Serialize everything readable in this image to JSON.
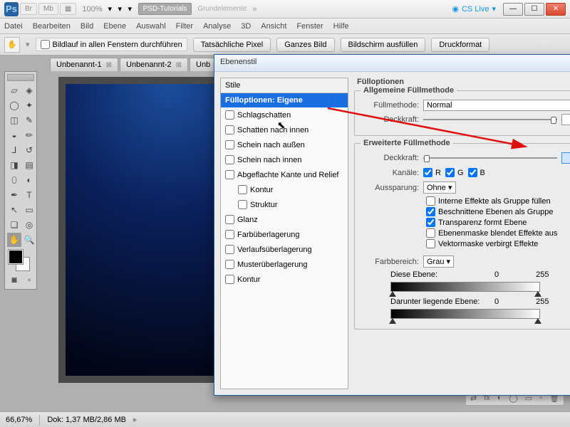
{
  "app": {
    "logo": "Ps",
    "zoom_label": "100%",
    "workspace": "PSD-Tutorials",
    "workspace2": "Grundelemente",
    "cslive": "CS Live"
  },
  "titlebar_buttons": [
    "Br",
    "Mb",
    "▦"
  ],
  "menu": [
    "Datei",
    "Bearbeiten",
    "Bild",
    "Ebene",
    "Auswahl",
    "Filter",
    "Analyse",
    "3D",
    "Ansicht",
    "Fenster",
    "Hilfe"
  ],
  "optionsbar": {
    "scroll_all": "Bildlauf in allen Fenstern durchführen",
    "btns": [
      "Tatsächliche Pixel",
      "Ganzes Bild",
      "Bildschirm ausfüllen",
      "Druckformat"
    ]
  },
  "tabs": [
    "Unbenannt-1",
    "Unbenannt-2",
    "Unb"
  ],
  "status": {
    "zoom": "66,67%",
    "doc": "Dok: 1,37 MB/2,86 MB"
  },
  "dialog": {
    "title": "Ebenenstil",
    "styles_header": "Stile",
    "items": [
      {
        "label": "Fülloptionen: Eigene",
        "checkbox": false,
        "selected": true
      },
      {
        "label": "Schlagschatten",
        "checkbox": true
      },
      {
        "label": "Schatten nach innen",
        "checkbox": true
      },
      {
        "label": "Schein nach außen",
        "checkbox": true
      },
      {
        "label": "Schein nach innen",
        "checkbox": true
      },
      {
        "label": "Abgeflachte Kante und Relief",
        "checkbox": true
      },
      {
        "label": "Kontur",
        "checkbox": true,
        "indent": true
      },
      {
        "label": "Struktur",
        "checkbox": true,
        "indent": true
      },
      {
        "label": "Glanz",
        "checkbox": true
      },
      {
        "label": "Farbüberlagerung",
        "checkbox": true
      },
      {
        "label": "Verlaufsüberlagerung",
        "checkbox": true
      },
      {
        "label": "Musterüberlagerung",
        "checkbox": true
      },
      {
        "label": "Kontur",
        "checkbox": true
      }
    ],
    "fill_options_title": "Fülloptionen",
    "general_title": "Allgemeine Füllmethode",
    "blend_mode_label": "Füllmethode:",
    "blend_mode_value": "Normal",
    "opacity_label": "Deckkraft:",
    "opacity_value": "100",
    "advanced_title": "Erweiterte Füllmethode",
    "adv_opacity_label": "Deckkraft:",
    "adv_opacity_value": "0",
    "channels_label": "Kanäle:",
    "channels": [
      "R",
      "G",
      "B"
    ],
    "knockout_label": "Aussparung:",
    "knockout_value": "Ohne",
    "checks": [
      {
        "label": "Interne Effekte als Gruppe füllen",
        "checked": false
      },
      {
        "label": "Beschnittene Ebenen als Gruppe",
        "checked": true
      },
      {
        "label": "Transparenz formt Ebene",
        "checked": true
      },
      {
        "label": "Ebenenmaske blendet Effekte aus",
        "checked": false
      },
      {
        "label": "Vektormaske verbirgt Effekte",
        "checked": false
      }
    ],
    "blendif_label": "Farbbereich:",
    "blendif_value": "Grau",
    "this_layer_label": "Diese Ebene:",
    "this_layer_lo": "0",
    "this_layer_hi": "255",
    "under_layer_label": "Darunter liegende Ebene:",
    "under_layer_lo": "0",
    "under_layer_hi": "255",
    "percent": "%"
  }
}
